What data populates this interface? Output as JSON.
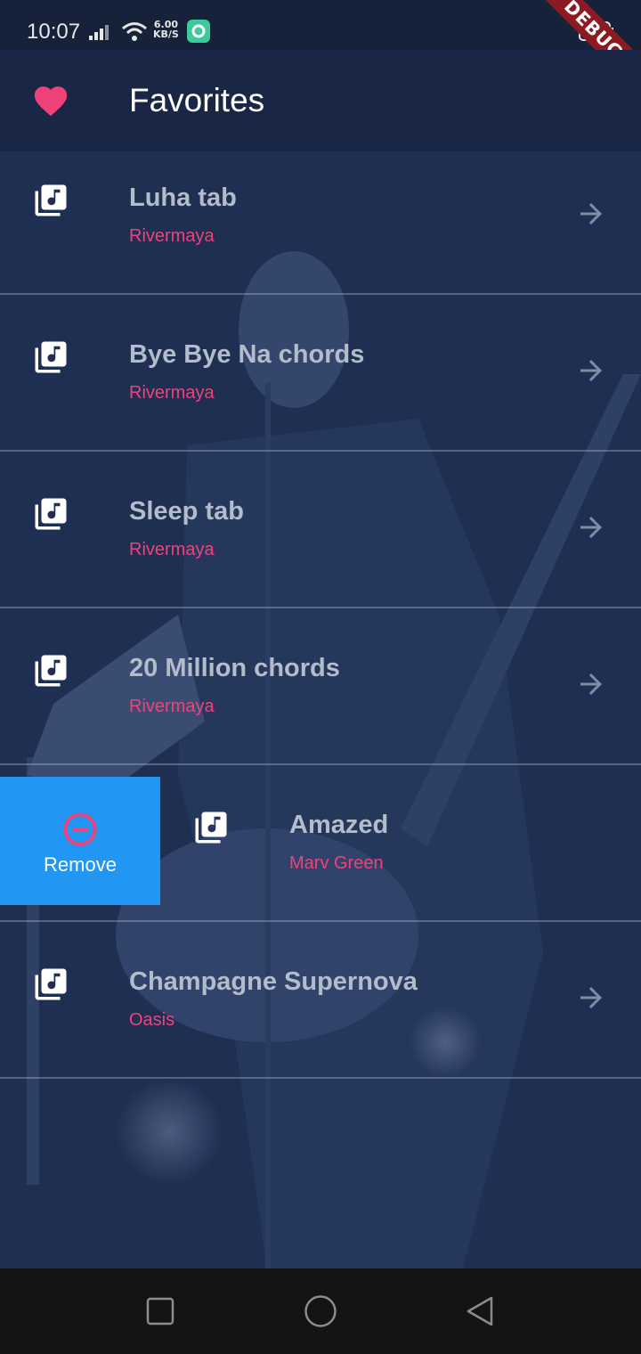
{
  "status_bar": {
    "time": "10:07",
    "net_speed_value": "6.00",
    "net_speed_unit": "KB/S",
    "debug_label": "DEBUG"
  },
  "app_bar": {
    "title": "Favorites",
    "icon": "heart-icon"
  },
  "favorites": [
    {
      "title": "Luha tab",
      "artist": "Rivermaya"
    },
    {
      "title": "Bye Bye Na chords",
      "artist": "Rivermaya"
    },
    {
      "title": "Sleep tab",
      "artist": "Rivermaya"
    },
    {
      "title": "20 Million chords",
      "artist": "Rivermaya"
    },
    {
      "title": "Amazed",
      "artist": "Marv Green"
    },
    {
      "title": "Champagne Supernova",
      "artist": "Oasis"
    }
  ],
  "swipe_action": {
    "label": "Remove",
    "icon": "minus-circle-icon"
  },
  "colors": {
    "accent_pink": "#f0427a",
    "remove_blue": "#2196f3",
    "app_bar": "#192645"
  },
  "nav_bar": {
    "recents": "square-icon",
    "home": "circle-icon",
    "back": "triangle-back-icon"
  }
}
